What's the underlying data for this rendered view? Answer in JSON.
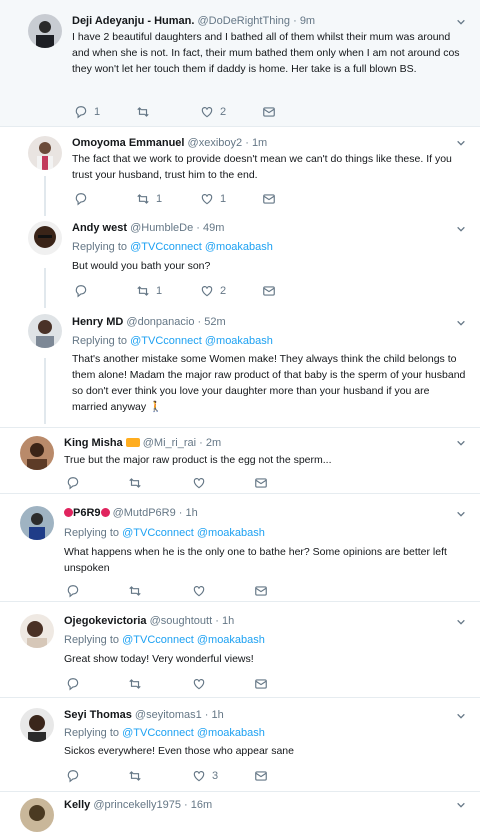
{
  "tweets": [
    {
      "name": "Deji Adeyanju - Human.",
      "handle": "@DoDeRightThing",
      "time": "9m",
      "replying": "",
      "text": "I have 2 beautiful daughters and I bathed all of them whilst their mum was around and when she is not. In fact, their mum bathed them only when I am not around cos they won't let her touch them if daddy is home. Her take is a full blown BS.",
      "reply_count": "1",
      "retweet_count": "",
      "like_count": "2"
    },
    {
      "name": "Omoyoma Emmanuel",
      "handle": "@xexiboy2",
      "time": "1m",
      "replying": "",
      "text": "The fact that we  work to provide doesn't mean we can't do things like these. If you trust your husband, trust him to the end.",
      "reply_count": "",
      "retweet_count": "1",
      "like_count": "1"
    },
    {
      "name": "Andy west",
      "handle": "@HumbleDe",
      "time": "49m",
      "replying_prefix": "Replying to",
      "replying": "@TVCconnect @moakabash",
      "text": "But would you bath your son?",
      "reply_count": "",
      "retweet_count": "1",
      "like_count": "2"
    },
    {
      "name": "Henry MD",
      "handle": "@donpanacio",
      "time": "52m",
      "replying_prefix": "Replying to",
      "replying": "@TVCconnect @moakabash",
      "text": "That's another mistake some Women make! They always think the child belongs to them alone! Madam the major raw product of that baby is the sperm of your husband so don't ever think you love your daughter more than your husband if you are married anyway 🚶",
      "reply_count": "",
      "retweet_count": "",
      "like_count": ""
    },
    {
      "name": "King Misha",
      "handle": "@Mi_ri_rai",
      "time": "2m",
      "replying": "",
      "text": "True but the major raw product is the egg not the sperm...",
      "reply_count": "",
      "retweet_count": "",
      "like_count": ""
    },
    {
      "name": "P6R9",
      "handle": "@MutdP6R9",
      "time": "1h",
      "replying_prefix": "Replying to",
      "replying": "@TVCconnect @moakabash",
      "text": "What happens when he is the only one to bathe her? Some opinions are better left unspoken",
      "reply_count": "",
      "retweet_count": "",
      "like_count": ""
    },
    {
      "name": "Ojegokevictoria",
      "handle": "@soughtoutt",
      "time": "1h",
      "replying_prefix": "Replying to",
      "replying": "@TVCconnect @moakabash",
      "text": "Great show today! Very wonderful views!",
      "reply_count": "",
      "retweet_count": "",
      "like_count": ""
    },
    {
      "name": "Seyi Thomas",
      "handle": "@seyitomas1",
      "time": "1h",
      "replying_prefix": "Replying to",
      "replying": "@TVCconnect @moakabash",
      "text": "Sickos everywhere! Even those who appear sane",
      "reply_count": "",
      "retweet_count": "",
      "like_count": "3"
    },
    {
      "name": "Kelly",
      "handle": "@princekelly1975",
      "time": "16m",
      "replying": "",
      "text": "",
      "reply_count": "",
      "retweet_count": "",
      "like_count": ""
    }
  ],
  "sep": "·",
  "colors": {
    "accent": "#1da1f2",
    "muted": "#657786",
    "border": "#e6ecf0",
    "highlight_bg": "#f5f8fa"
  },
  "icons": [
    "reply-icon",
    "retweet-icon",
    "like-icon",
    "message-icon",
    "chevron-down-icon"
  ]
}
